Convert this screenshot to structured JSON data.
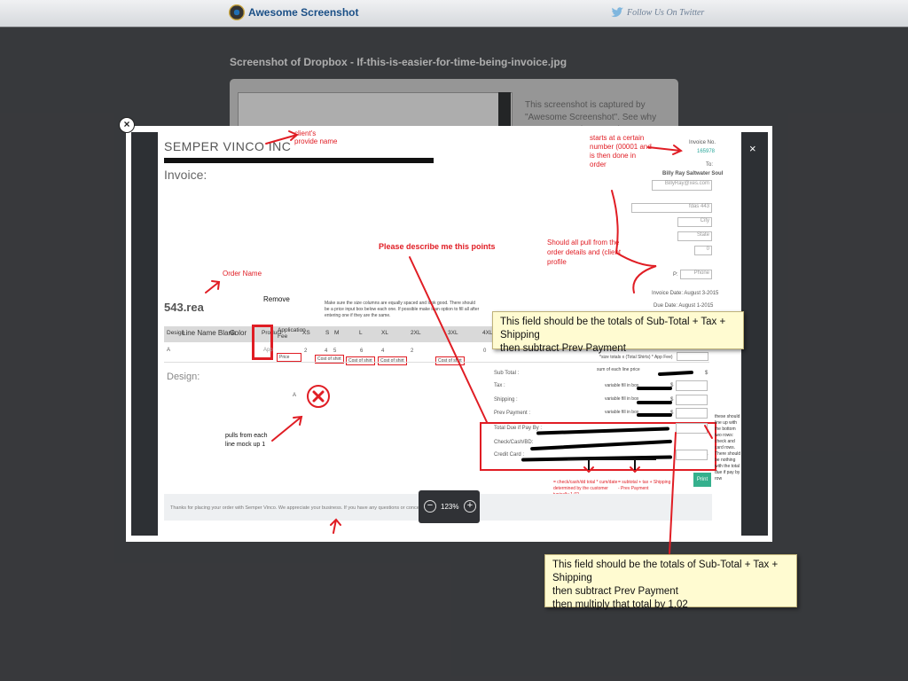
{
  "header": {
    "brand": "Awesome Screenshot",
    "twitter": "Follow Us On Twitter"
  },
  "page_heading": "Screenshot of  Dropbox - If-this-is-easier-for-time-being-invoice.jpg",
  "background_card": {
    "description": "This screenshot is captured by \"Awesome Screenshot\". See why so many people are raving"
  },
  "viewer": {
    "zoom": "123%",
    "close": "×"
  },
  "invoice": {
    "company": "SEMPER VINCO INC",
    "title": "Invoice:",
    "order_name_value": "543.rea",
    "invoice_no_label": "Invoice No.",
    "invoice_no": "165978",
    "to_label": "To:",
    "client_name": "Billy Ray Saltwater Soul",
    "client_email": "BillyRay@xes.com",
    "address": "fdas 443",
    "city": "City",
    "state": "State",
    "zip": "0",
    "phone_prefix": "P:",
    "phone": "Phone",
    "invoice_date": "Invoice Date:  August 3-2015",
    "due_date": "Due Date:  August 1-2015",
    "table_headers": [
      "Design",
      "Line Name Blank",
      "Color",
      "Product",
      "Application Fee",
      "XS",
      "S",
      "M",
      "L",
      "XL",
      "2XL",
      "3XL",
      "4XL"
    ],
    "row_first": "A",
    "row_app": "App",
    "row_price": "Price",
    "row_nums": [
      "2",
      "4",
      "5",
      "6",
      "4",
      "2",
      "0"
    ],
    "cost_cells": [
      "Cost of shirt",
      "Cost of shirt",
      "Cost of shirt",
      "Cost of shirt"
    ],
    "design_label": "Design:",
    "design_letter": "A",
    "note_sizes": "Make sure the size columns are equally spaced and look good. There should be a price input box below each one.  If possible make it an option to fill all after entering one if they are the same.",
    "sum_formula": "*size totals x (Total Shirts) * App Fee)",
    "sum_each_line": "sum of each line price",
    "sub_total": "Sub Total :",
    "tax": "Tax :",
    "shipping": "Shipping :",
    "prev_payment": "Prev Payment :",
    "var_fill": "variable fill in box",
    "dollar": "$",
    "total_due": "Total Due if Pay By :",
    "check_cash": "Check/Cash/BD:",
    "credit_card": "Credit Card :",
    "print": "Print",
    "footer": "Thanks for placing your order with Semper Vinco. We appreciate your business. If you have any questions or concerns don't h"
  },
  "annotations": {
    "client_name_note": "client's provide name",
    "invoice_number_note": "starts at a certain number (00001 and is then done in order",
    "pull_note": "Should all pull from the order details and (client profile",
    "describe": "Please describe me this points",
    "order_name": "Order Name",
    "remove": "Remove",
    "pulls_from": "pulls from each line mock up 1",
    "check_cash_note": "= check/cash/dd total * cum/date determined by the customer typically 1.02",
    "subtotal_note": "= subtotal + tax + Shipping - Prev Payment",
    "bottom_note": "these should line up with the bottom two rows: check and card rows. There should be nothing with the total due if pay by row"
  },
  "callouts": {
    "top": [
      "This field should be the totals of Sub-Total + Tax + Shipping",
      "then subtract Prev Payment"
    ],
    "bottom": [
      "This field should be the totals of Sub-Total + Tax + Shipping",
      "then subtract Prev Payment",
      "then multiply that total by 1.02"
    ]
  }
}
